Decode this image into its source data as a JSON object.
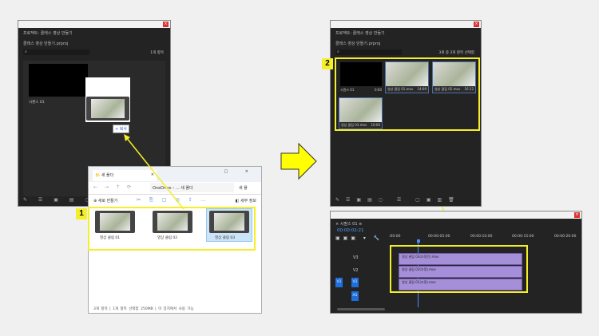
{
  "left_project": {
    "title": "프로젝트: 클래스 영상 만들기",
    "file": "클래스 영상 만들기.prproj",
    "count": "1개 항목",
    "sequence": "시퀀스 01",
    "drag_tooltip": "+ 복사"
  },
  "explorer": {
    "tab": "새 폴더",
    "path_root": "OneDrive",
    "path_folder": "새 폴더",
    "search": "새 폴",
    "new_button": "새로 만들기",
    "details_button": "세부 정보",
    "files": [
      {
        "name": "영상 클립 01"
      },
      {
        "name": "영상 클립 02"
      },
      {
        "name": "영상 클립 03"
      }
    ],
    "status": {
      "items": "3개 항목",
      "selected": "1개 항목 선택함 250MB",
      "available": "이 장치에서 사용 가능"
    }
  },
  "right_project": {
    "title": "프로젝트: 클래스 영상 만들기",
    "file": "클래스 영상 만들기.prproj",
    "count": "3개 중 3개 항목 선택함",
    "items": [
      {
        "name": "시퀀스 01",
        "dur": "0:00"
      },
      {
        "name": "영상 클립 01.mov",
        "dur": "14:09"
      },
      {
        "name": "영상 클립 02.mov",
        "dur": "16:12"
      },
      {
        "name": "영상 클립 03.mov",
        "dur": "10:00"
      }
    ]
  },
  "timeline": {
    "title": "시퀀스 01",
    "timecode": "00:00:02:21",
    "ruler": [
      ":00:00",
      "00:00:05:00",
      "00:00:10:00",
      "00:00:15:00",
      "00:00:20:00"
    ],
    "tracks": [
      "V3",
      "V2",
      "V1",
      "A1"
    ],
    "source": "V1",
    "clips": [
      "영상 클립 03(조정전).mov",
      "영상 클립 02(조정).mov",
      "영상 클립 01(조정).mov"
    ]
  },
  "steps": [
    "1",
    "2"
  ],
  "colors": {
    "highlight": "#f5ee2a",
    "accent": "#1e6fd9",
    "clip": "#a58fd8"
  }
}
